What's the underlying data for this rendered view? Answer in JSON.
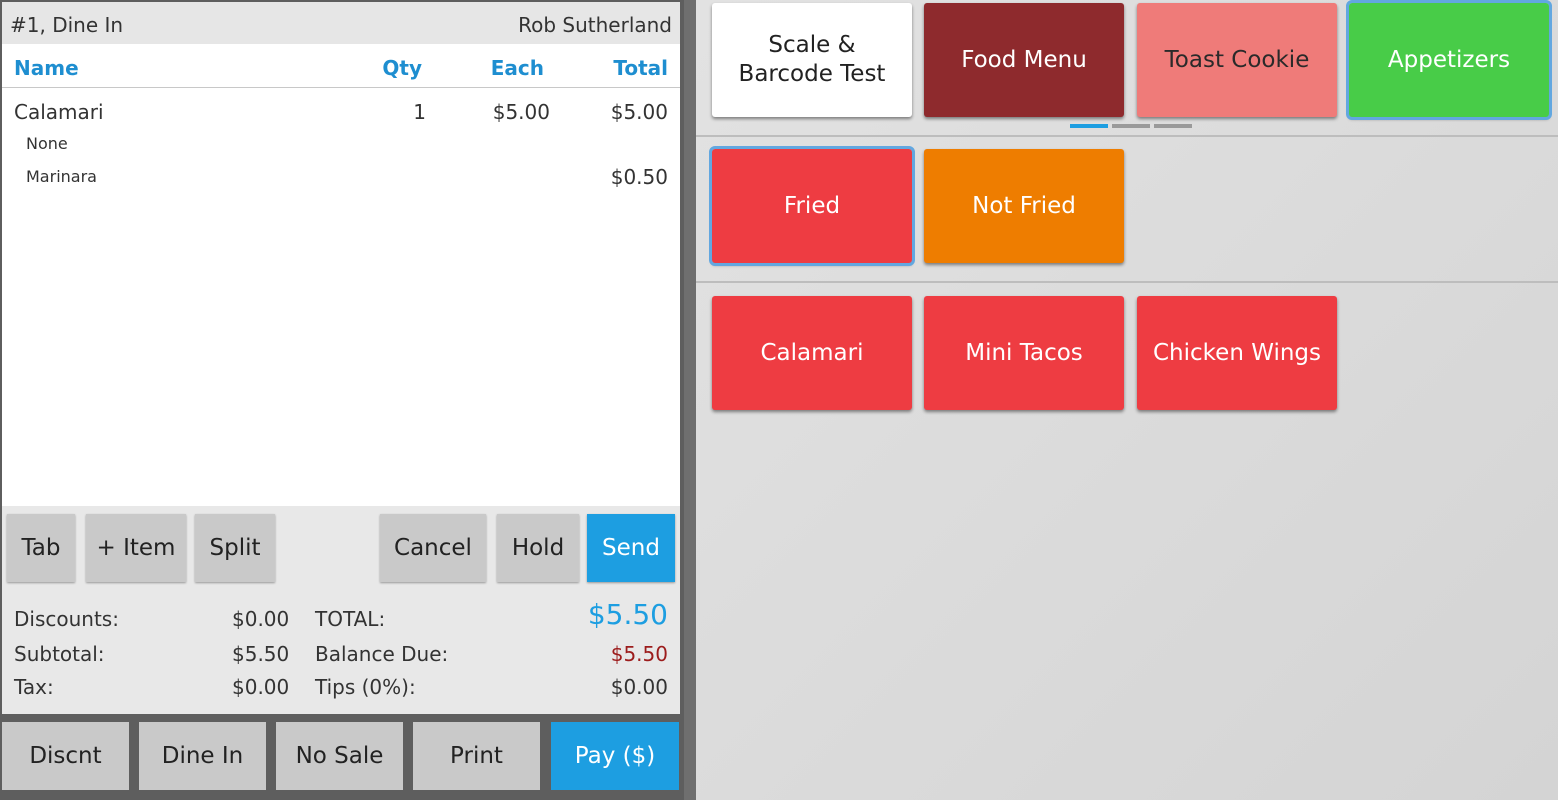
{
  "order": {
    "number": "#1, Dine In",
    "server": "Rob Sutherland",
    "columns": {
      "name": "Name",
      "qty": "Qty",
      "each": "Each",
      "total": "Total"
    },
    "items": [
      {
        "name": "Calamari",
        "qty": "1",
        "each": "$5.00",
        "total": "$5.00",
        "modifiers": [
          {
            "name": "None",
            "total": ""
          },
          {
            "name": "Marinara",
            "total": "$0.50"
          }
        ]
      }
    ]
  },
  "actions": {
    "tab": "Tab",
    "add_item": "+ Item",
    "split": "Split",
    "cancel": "Cancel",
    "hold": "Hold",
    "send": "Send"
  },
  "totals": {
    "discounts_label": "Discounts:",
    "discounts_value": "$0.00",
    "subtotal_label": "Subtotal:",
    "subtotal_value": "$5.50",
    "tax_label": "Tax:",
    "tax_value": "$0.00",
    "total_label": "TOTAL:",
    "total_value": "$5.50",
    "balance_label": "Balance Due:",
    "balance_value": "$5.50",
    "tips_label": "Tips (0%):",
    "tips_value": "$0.00"
  },
  "footer": {
    "discount": "Discnt",
    "dine_in": "Dine In",
    "no_sale": "No Sale",
    "print": "Print",
    "pay": "Pay ($)"
  },
  "menu": {
    "categories": [
      {
        "label": "Scale &\nBarcode Test",
        "color": "#ffffff"
      },
      {
        "label": "Food Menu",
        "color": "#8e2a2d"
      },
      {
        "label": "Toast Cookie",
        "color": "#ef7b79"
      },
      {
        "label": "Appetizers",
        "color": "#48cc48",
        "selected": true
      }
    ],
    "page_indicator": {
      "pages": 3,
      "active": 1
    },
    "subcategories": [
      {
        "label": "Fried",
        "color": "#ee3c42",
        "selected": true
      },
      {
        "label": "Not Fried",
        "color": "#ee7d00"
      }
    ],
    "items": [
      {
        "label": "Calamari",
        "color": "#ee3c42"
      },
      {
        "label": "Mini Tacos",
        "color": "#ee3c42"
      },
      {
        "label": "Chicken Wings",
        "color": "#ee3c42"
      }
    ]
  }
}
